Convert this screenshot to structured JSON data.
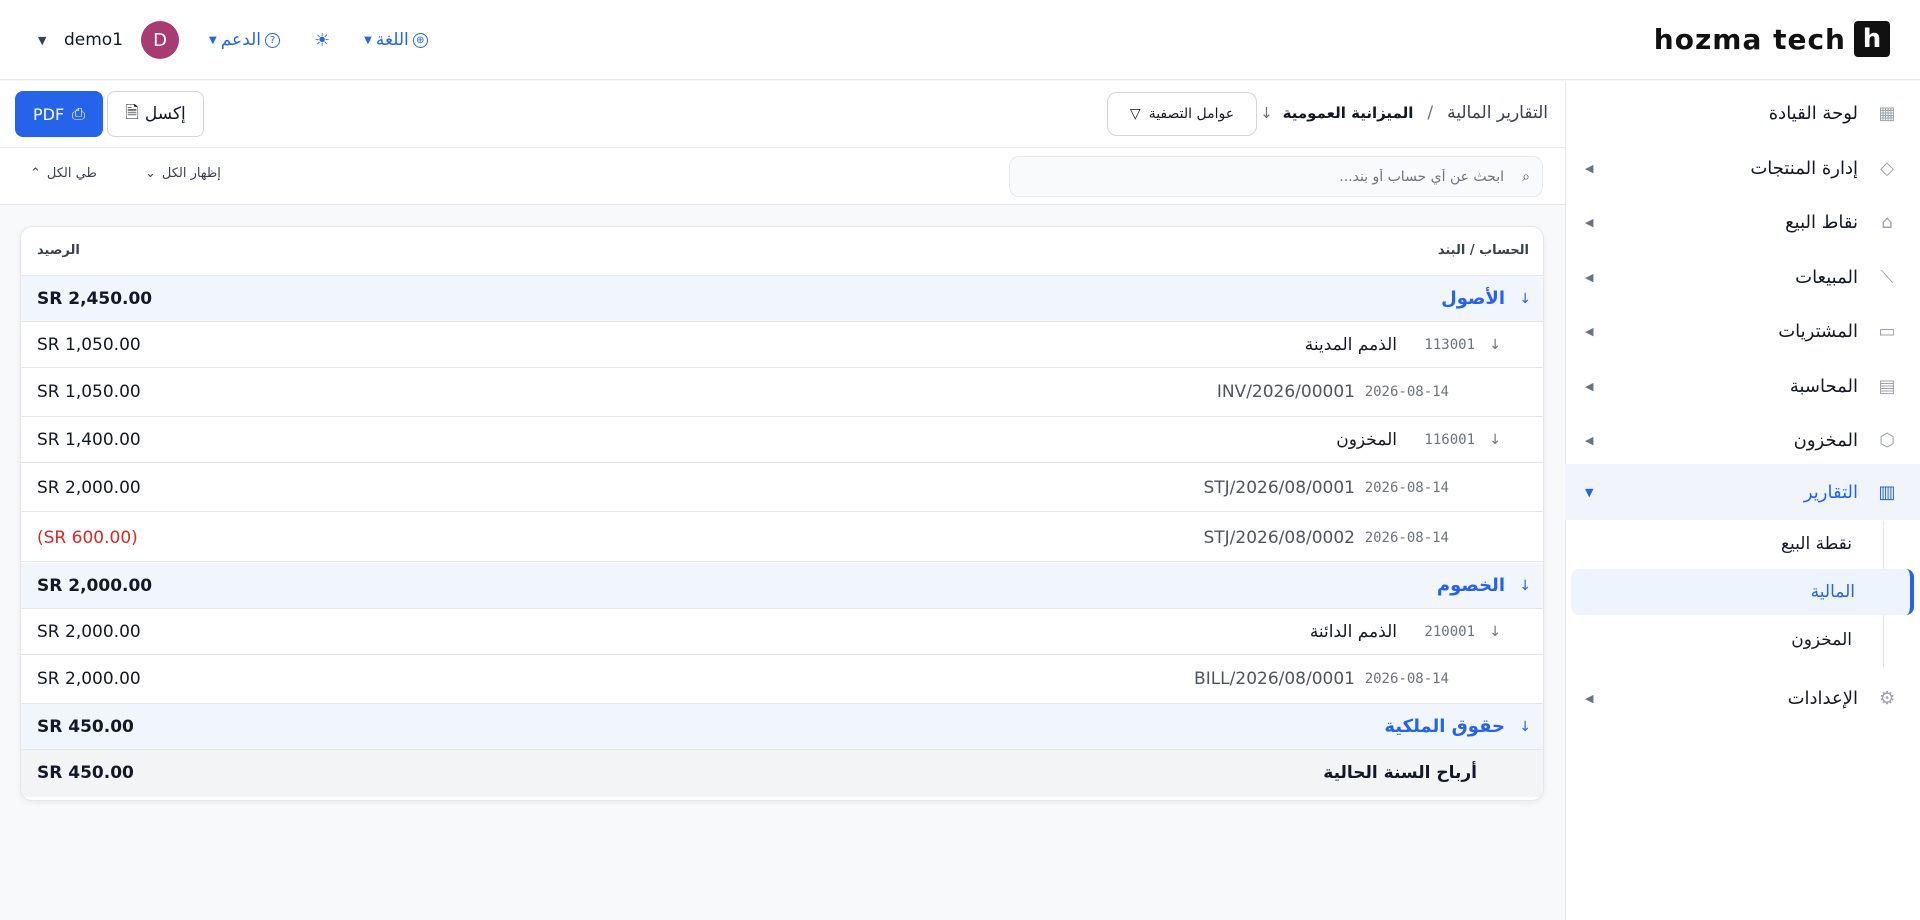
{
  "brand": {
    "mark": "h",
    "name": "hozma tech"
  },
  "topbar": {
    "user": "demo1",
    "avatar_letter": "D",
    "support": "الدعم",
    "language": "اللغة"
  },
  "sidebar": {
    "items": [
      {
        "label": "لوحة القيادة",
        "icon": "dashboard-icon",
        "arrow": ""
      },
      {
        "label": "إدارة المنتجات",
        "icon": "tag-icon",
        "arrow": "◀"
      },
      {
        "label": "نقاط البيع",
        "icon": "store-icon",
        "arrow": "◀"
      },
      {
        "label": "المبيعات",
        "icon": "chart-line-icon",
        "arrow": "◀"
      },
      {
        "label": "المشتريات",
        "icon": "card-icon",
        "arrow": "◀"
      },
      {
        "label": "المحاسبة",
        "icon": "ledger-icon",
        "arrow": "◀"
      },
      {
        "label": "المخزون",
        "icon": "box-icon",
        "arrow": "◀"
      },
      {
        "label": "التقارير",
        "icon": "report-icon",
        "arrow": "▼"
      },
      {
        "label": "الإعدادات",
        "icon": "gear-icon",
        "arrow": "◀"
      }
    ],
    "reports_sub": [
      "نقطة البيع",
      "المالية",
      "المخزون"
    ]
  },
  "toolbar": {
    "breadcrumb_root": "التقارير المالية",
    "breadcrumb_sep": "/",
    "breadcrumb_current": "الميزانية العمومية",
    "filters": "عوامل التصفية",
    "excel": "إكسل",
    "pdf": "PDF"
  },
  "search": {
    "placeholder": "ابحث عن أي حساب أو بند...",
    "expand_all": "إظهار الكل",
    "collapse_all": "طي الكل"
  },
  "report": {
    "col_account": "الحساب / البند",
    "col_balance": "الرصيد",
    "rows": [
      {
        "type": "group",
        "name": "الأصول",
        "amount": "SR 2,450.00"
      },
      {
        "type": "account",
        "code": "113001",
        "name": "الذمم المدينة",
        "amount": "SR 1,050.00"
      },
      {
        "type": "line",
        "date": "2026-08-14",
        "ref": "INV/2026/00001",
        "amount": "SR 1,050.00"
      },
      {
        "type": "account",
        "code": "116001",
        "name": "المخزون",
        "amount": "SR 1,400.00"
      },
      {
        "type": "line",
        "date": "2026-08-14",
        "ref": "STJ/2026/08/0001",
        "amount": "SR 2,000.00"
      },
      {
        "type": "line",
        "date": "2026-08-14",
        "ref": "STJ/2026/08/0002",
        "amount": "(SR 600.00)"
      },
      {
        "type": "group",
        "name": "الخصوم",
        "amount": "SR 2,000.00"
      },
      {
        "type": "account",
        "code": "210001",
        "name": "الذمم الدائنة",
        "amount": "SR 2,000.00"
      },
      {
        "type": "line",
        "date": "2026-08-14",
        "ref": "BILL/2026/08/0001",
        "amount": "SR 2,000.00"
      },
      {
        "type": "group",
        "name": "حقوق الملكية",
        "amount": "SR 450.00"
      },
      {
        "type": "total",
        "name": "أرباح السنة الحالية",
        "amount": "SR 450.00"
      }
    ]
  },
  "colors": {
    "accent": "#2563eb",
    "negative": "#dc2626",
    "avatar": "#a83a74"
  }
}
